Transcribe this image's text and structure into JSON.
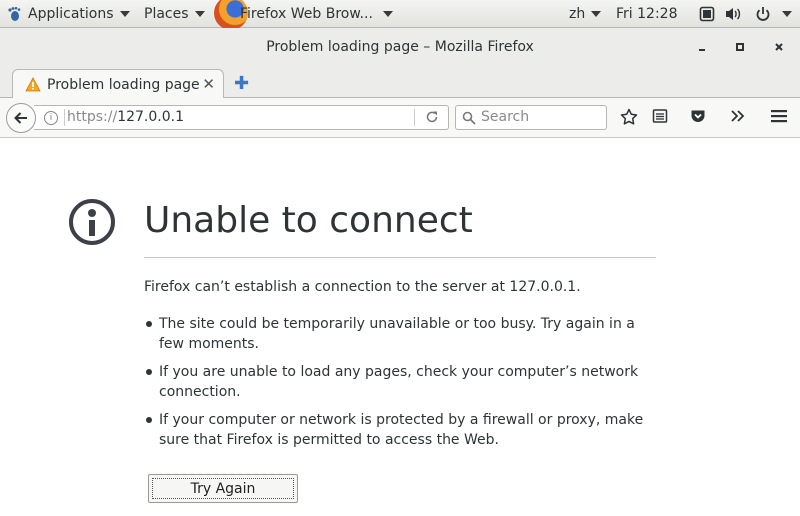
{
  "topbar": {
    "applications_label": "Applications",
    "places_label": "Places",
    "active_app_label": "Firefox Web Brow...",
    "input_method": "zh",
    "clock": "Fri 12:28",
    "icons": [
      "gnome-foot-icon",
      "firefox-logo-icon",
      "window-icon",
      "volume-icon",
      "power-icon"
    ]
  },
  "window": {
    "title": "Problem loading page – Mozilla Firefox"
  },
  "tabs": [
    {
      "label": "Problem loading page",
      "icon": "warning-icon"
    }
  ],
  "navbar": {
    "url_scheme": "https://",
    "url_host": "127.0.0.1",
    "search_placeholder": "Search"
  },
  "error_page": {
    "title": "Unable to connect",
    "description": "Firefox can’t establish a connection to the server at 127.0.0.1.",
    "bullets": [
      "The site could be temporarily unavailable or too busy. Try again in a few moments.",
      "If you are unable to load any pages, check your computer’s network connection.",
      "If your computer or network is protected by a firewall or proxy, make sure that Firefox is permitted to access the Web."
    ],
    "try_again_label": "Try Again"
  },
  "colors": {
    "text": "#2e3436",
    "accent_blue": "#3b77c4",
    "warning": "#f5a623",
    "info_icon": "#3d4049"
  }
}
